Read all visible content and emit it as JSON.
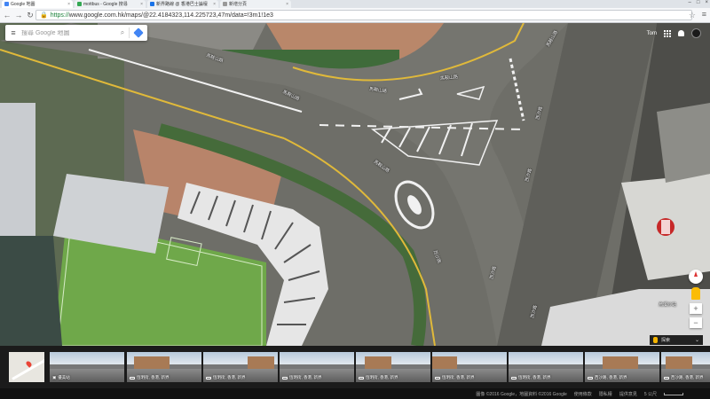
{
  "browser": {
    "tabs": [
      {
        "title": "Google 地圖",
        "active": true
      },
      {
        "title": "mottbus - Google 搜尋",
        "active": false
      },
      {
        "title": "新界路線 @ 香港巴士論壇",
        "active": false
      },
      {
        "title": "新增分頁",
        "active": false
      }
    ],
    "url_secure": "https://",
    "url_rest": "www.google.com.hk/maps/@22.4184323,114.225723,47m/data=!3m1!1e3"
  },
  "search": {
    "placeholder": "搜尋 Google 地圖"
  },
  "account": {
    "label": "Tom"
  },
  "map": {
    "view": "satellite",
    "road_labels": [
      "馬鞍山路",
      "馬鞍山路",
      "馬鞍山路",
      "馬鞍山路",
      "馬鞍山路",
      "馬鞍山路",
      "西沙路",
      "西沙路",
      "西沙路",
      "西沙路",
      "西沙路"
    ],
    "station_label": "烏溪沙站"
  },
  "explore": {
    "label": "探索"
  },
  "photos": [
    {
      "caption": "",
      "kind": "map"
    },
    {
      "caption": "優美站",
      "kind": "photo"
    },
    {
      "caption": "恆明街, 香港, 新界",
      "kind": "photo"
    },
    {
      "caption": "恆明街, 香港, 新界",
      "kind": "photo"
    },
    {
      "caption": "恆明街, 香港, 新界",
      "kind": "photo"
    },
    {
      "caption": "恆明街, 香港, 新界",
      "kind": "photo"
    },
    {
      "caption": "恆明街, 香港, 新界",
      "kind": "photo"
    },
    {
      "caption": "恆明街, 香港, 新界",
      "kind": "photo"
    },
    {
      "caption": "恆明街, 香港, 新界",
      "kind": "photo"
    },
    {
      "caption": "西沙路, 香港, 新界",
      "kind": "photo"
    },
    {
      "caption": "西沙路, 香港, 新界",
      "kind": "photo"
    }
  ],
  "footer": {
    "imagery": "圖像 ©2016 Google，地圖資料 ©2016 Google",
    "terms": "使用條款",
    "privacy": "隱私權",
    "feedback": "提供意見",
    "scale": "5 公尺"
  },
  "colors": {
    "accent": "#4285f4",
    "map_road": "#6f6f6a",
    "field_green": "#6fa84a"
  }
}
